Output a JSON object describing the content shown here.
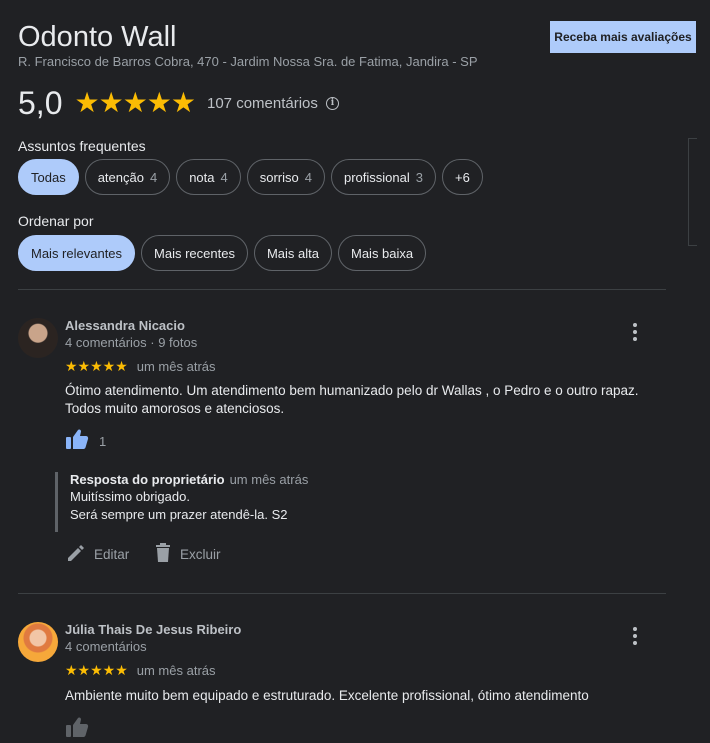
{
  "header": {
    "title": "Odonto Wall",
    "address": "R. Francisco de Barros Cobra, 470 - Jardim Nossa Sra. de Fatima, Jandira - SP",
    "cta_label": "Receba mais avaliações"
  },
  "summary": {
    "rating": "5,0",
    "stars": "★★★★★",
    "count_label": "107 comentários",
    "info_glyph": "i"
  },
  "topics": {
    "label": "Assuntos frequentes",
    "chips": [
      {
        "label": "Todas",
        "count": ""
      },
      {
        "label": "atenção",
        "count": "4"
      },
      {
        "label": "nota",
        "count": "4"
      },
      {
        "label": "sorriso",
        "count": "4"
      },
      {
        "label": "profissional",
        "count": "3"
      },
      {
        "label": "+6",
        "count": ""
      }
    ]
  },
  "sort": {
    "label": "Ordenar por",
    "options": [
      "Mais relevantes",
      "Mais recentes",
      "Mais alta",
      "Mais baixa"
    ]
  },
  "reviews": [
    {
      "name": "Alessandra Nicacio",
      "meta": "4 comentários · 9 fotos",
      "stars": "★★★★★",
      "time": "um mês atrás",
      "text": "Ótimo atendimento. Um atendimento bem humanizado pelo dr Wallas , o Pedro e o outro rapaz. Todos muito amorosos e atenciosos.",
      "likes": "1",
      "reply": {
        "owner": "Resposta do proprietário",
        "time": "um mês atrás",
        "line1": "Muitíssimo obrigado.",
        "line2": "Será sempre um prazer atendê-la. S2"
      },
      "edit_label": "Editar",
      "delete_label": "Excluir"
    },
    {
      "name": "Júlia Thais De Jesus Ribeiro",
      "meta": "4 comentários",
      "stars": "★★★★★",
      "time": "um mês atrás",
      "text": "Ambiente muito bem equipado e estruturado. Excelente profissional, ótimo atendimento"
    }
  ],
  "colors": {
    "background": "#202124",
    "accent": "#aecbfa",
    "star": "#fbbc04",
    "thumb": "#8ab4f8"
  },
  "icons": [
    "info-icon",
    "more-vert-icon",
    "thumb-up-icon",
    "edit-icon",
    "delete-icon"
  ]
}
